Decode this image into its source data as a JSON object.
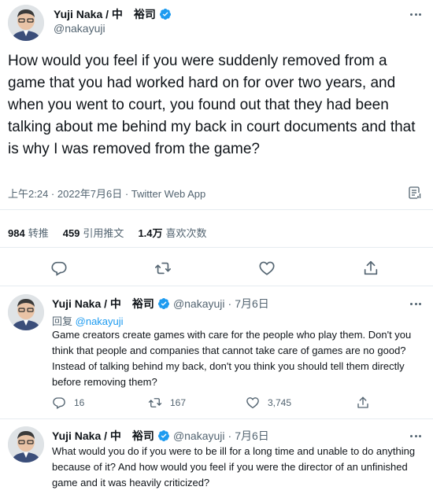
{
  "main_tweet": {
    "author_name": "Yuji Naka / 中　裕司",
    "handle": "@nakayuji",
    "text": "How would you feel if you were suddenly removed from a game that you had worked hard on for over two years, and when you went to court, you found out that they had been talking about me behind my back in court documents and that is why I was removed from the game?",
    "timestamp": "上午2:24 · 2022年7月6日 · Twitter Web App",
    "stats": {
      "retweets_count": "984",
      "retweets_label": "转推",
      "quotes_count": "459",
      "quotes_label": "引用推文",
      "likes_count": "1.4万",
      "likes_label": "喜欢次数"
    }
  },
  "replies": [
    {
      "author_name": "Yuji Naka / 中　裕司",
      "handle": "@nakayuji",
      "date": "7月6日",
      "reply_prefix": "回复",
      "reply_to": "@nakayuji",
      "text": "Game creators create games with care for the people who play them. Don't you think that people and companies that cannot take care of games are no good? Instead of talking behind my back, don't you think you should tell them directly before removing them?",
      "reply_count": "16",
      "retweet_count": "167",
      "like_count": "3,745"
    },
    {
      "author_name": "Yuji Naka / 中　裕司",
      "handle": "@nakayuji",
      "date": "7月6日",
      "text": "What would you do if you were to be ill for a long time and unable to do anything because of it? And how would you feel if you were the director of an unfinished game and it was heavily criticized?"
    }
  ],
  "colors": {
    "accent": "#1d9bf0",
    "text": "#0f1419",
    "secondary": "#536471",
    "divider": "#e6ecf0"
  },
  "icons": {
    "verified": "verified-badge-icon",
    "more": "more-options-icon",
    "reply": "reply-icon",
    "retweet": "retweet-icon",
    "like": "heart-icon",
    "share": "share-icon",
    "analytics": "analytics-icon"
  }
}
